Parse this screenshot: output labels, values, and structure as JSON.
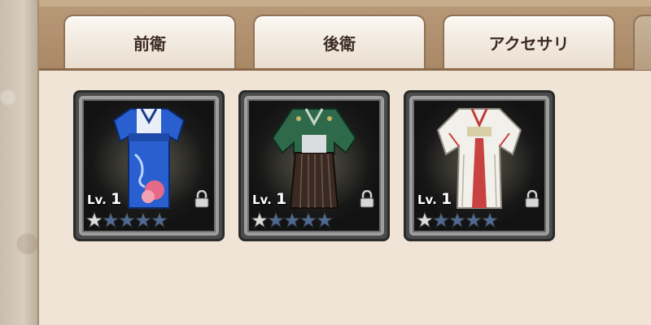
{
  "tabs": [
    {
      "label": "前衛",
      "active": false
    },
    {
      "label": "後衛",
      "active": false
    },
    {
      "label": "アクセサリ",
      "active": false
    }
  ],
  "items": [
    {
      "name_icon": "blue-furisode-kimono-icon",
      "level_prefix": "Lv.",
      "level": "1",
      "stars_filled": 1,
      "stars_total": 5,
      "locked": true
    },
    {
      "name_icon": "green-hakama-icon",
      "level_prefix": "Lv.",
      "level": "1",
      "stars_filled": 1,
      "stars_total": 5,
      "locked": true
    },
    {
      "name_icon": "white-miko-robe-icon",
      "level_prefix": "Lv.",
      "level": "1",
      "stars_filled": 1,
      "stars_total": 5,
      "locked": true
    }
  ],
  "colors": {
    "panel_bg": "#efe4d6",
    "tab_bar": "#a98866",
    "star_filled": "#d9d9d9",
    "star_empty": "#4e6a8f"
  }
}
